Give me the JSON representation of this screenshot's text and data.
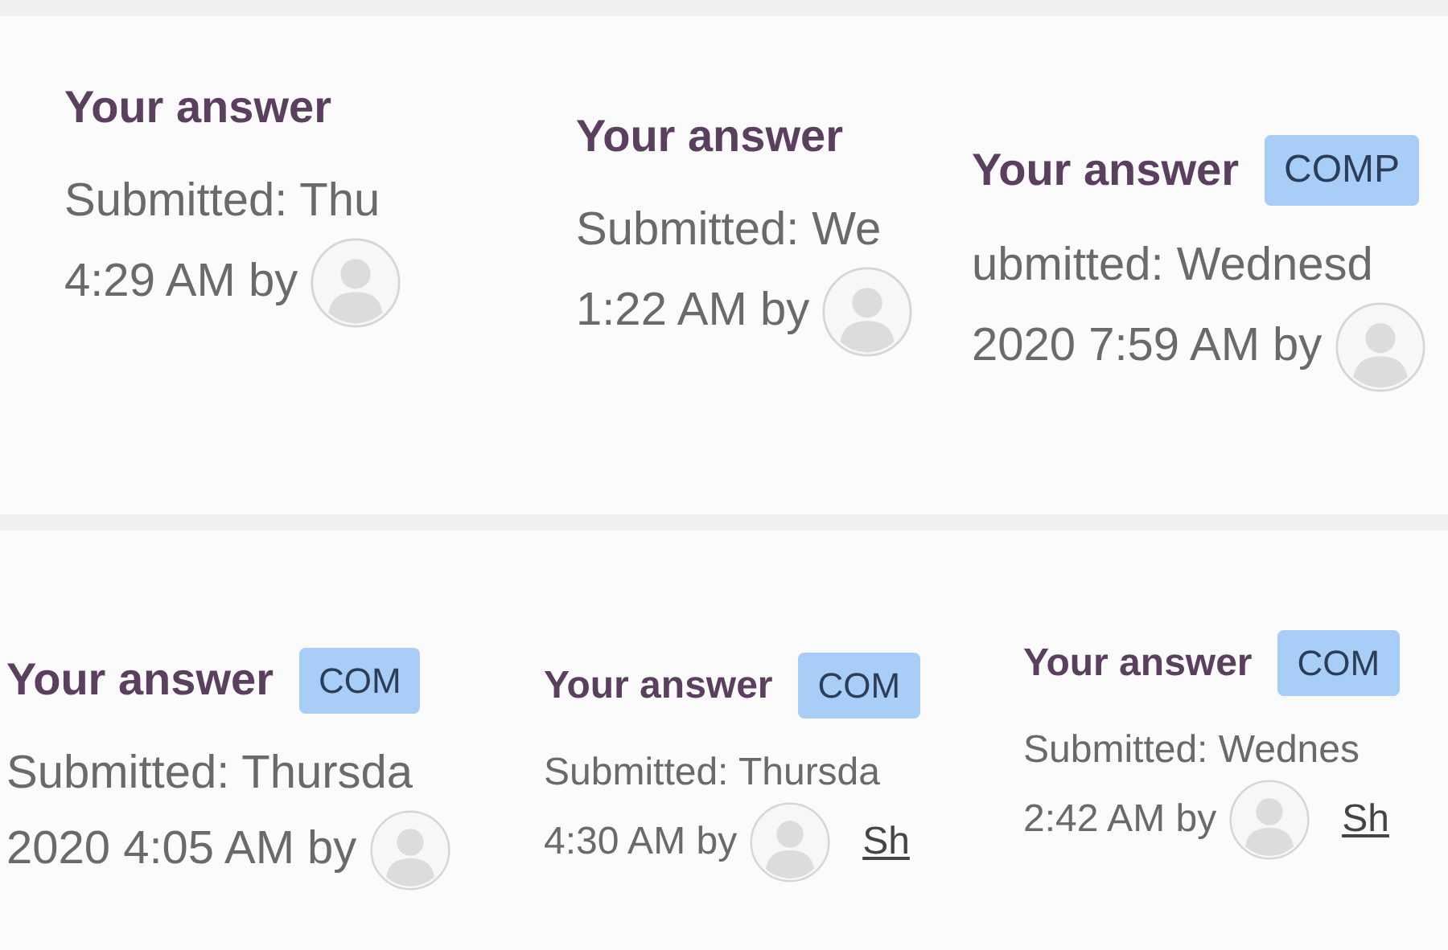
{
  "panels": [
    {
      "heading": "Your answer",
      "submitted": "Submitted: Thu",
      "time": "4:29 AM by"
    },
    {
      "heading": "Your answer",
      "submitted": "Submitted: We",
      "time": "1:22 AM by"
    },
    {
      "heading": "Your answer",
      "badge": "COMP",
      "submitted": "ubmitted: Wednesd",
      "time": "2020 7:59 AM by"
    },
    {
      "heading": "Your answer",
      "badge": "COM",
      "submitted": "Submitted: Thursda",
      "time": "2020 4:05 AM by"
    },
    {
      "heading": "Your answer",
      "badge": "COM",
      "submitted": "Submitted: Thursda",
      "time": "4:30 AM by",
      "author": "Sh"
    },
    {
      "heading": "Your answer",
      "badge": "COM",
      "submitted": "Submitted: Wednes",
      "time": "2:42 AM by",
      "author": "Sh"
    }
  ]
}
